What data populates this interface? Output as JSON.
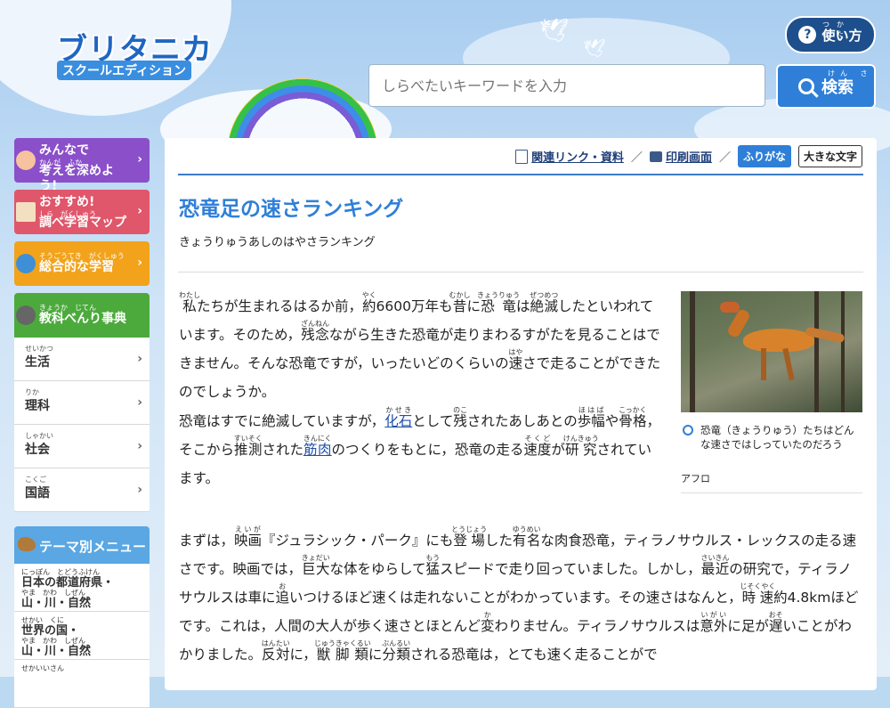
{
  "header": {
    "logo_main": "ブリタニカ",
    "logo_sub": "スクールエディション",
    "help_label": "使い方",
    "help_ruby": "つか かた",
    "search_placeholder": "しらべたいキーワードを入力",
    "search_label": "検索",
    "search_ruby": "けん さく"
  },
  "sidebar": {
    "cards": [
      {
        "line1": "みんなで",
        "ruby": "かんが　ふか",
        "line2": "考えを深めよう!",
        "color": "#8a4fc9"
      },
      {
        "line1": "おすすめ!",
        "ruby": "しら　がくしゅう",
        "line2": "調べ学習マップ",
        "color": "#e0566a"
      },
      {
        "line1": "",
        "ruby": "そうごうてき　がくしゅう",
        "line2": "総合的な学習",
        "color": "#f2a31b"
      },
      {
        "line1": "",
        "ruby": "きょうか　じてん",
        "line2": "教科べんり事典",
        "color": "#4caa3c"
      }
    ],
    "subjects": [
      {
        "ruby": "せいかつ",
        "label": "生活"
      },
      {
        "ruby": "りか",
        "label": "理科"
      },
      {
        "ruby": "しゃかい",
        "label": "社会"
      },
      {
        "ruby": "こくご",
        "label": "国語"
      }
    ],
    "theme_head": "テーマ別メニュー",
    "theme_items": [
      {
        "ruby": "にっぽん　とどうふけん",
        "line1": "日本の都道府県・",
        "ruby2": "やま　かわ　しぜん",
        "line2": "山・川・自然"
      },
      {
        "ruby": "せかい　くに",
        "line1": "世界の国・",
        "ruby2": "やま　かわ　しぜん",
        "line2": "山・川・自然"
      },
      {
        "ruby": "せかいいさん",
        "line1": "",
        "ruby2": "",
        "line2": ""
      }
    ]
  },
  "toolbar": {
    "related_link": "関連リンク・資料",
    "print_link": "印刷画面",
    "furigana": "ふりがな",
    "big_text": "大きな文字"
  },
  "article": {
    "title": "恐竜足の速さランキング",
    "yomi": "きょうりゅうあしのはやさランキング",
    "figure_caption": "恐竜（きょうりゅう）たちはどんな速さではしっていたのだろう",
    "figure_credit": "アフロ"
  }
}
